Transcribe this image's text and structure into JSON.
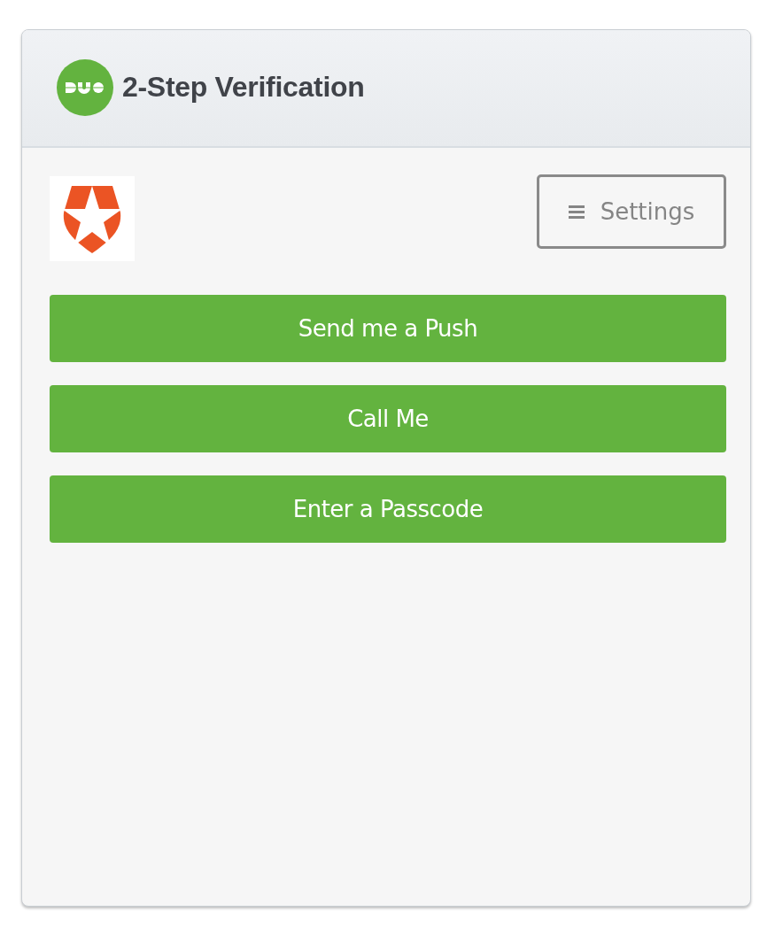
{
  "header": {
    "title": "2-Step Verification"
  },
  "settings_button": {
    "label": "Settings"
  },
  "buttons": [
    {
      "label": "Send me a Push"
    },
    {
      "label": "Call Me"
    },
    {
      "label": "Enter a Passcode"
    }
  ]
}
